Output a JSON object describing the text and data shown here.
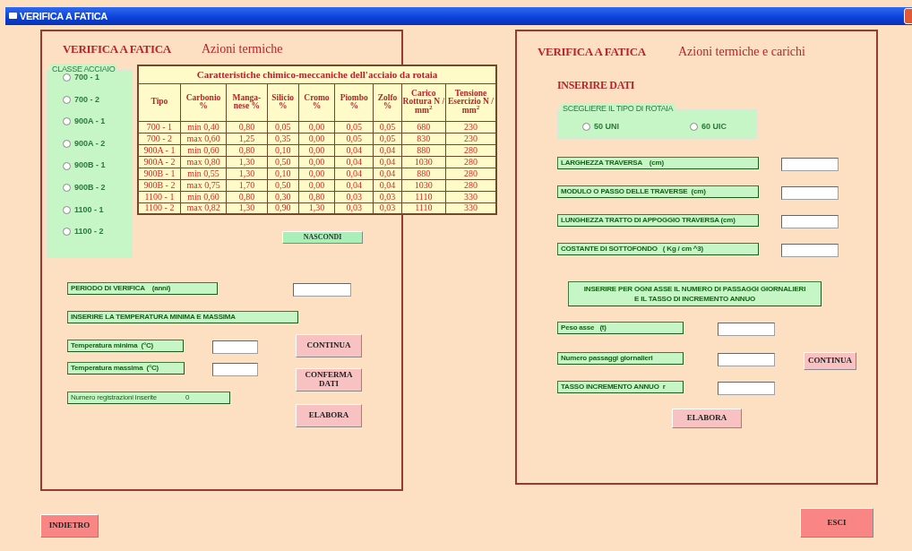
{
  "window": {
    "title": "VERIFICA A FATICA"
  },
  "left_panel": {
    "title": "VERIFICA A FATICA",
    "subtitle": "Azioni termiche",
    "steel_class": {
      "label": "CLASSE ACCIAIO",
      "options": [
        {
          "label": "700 - 1",
          "selected": false
        },
        {
          "label": "700 - 2",
          "selected": false
        },
        {
          "label": "900A - 1",
          "selected": false
        },
        {
          "label": "900A - 2",
          "selected": false
        },
        {
          "label": "900B - 1",
          "selected": false
        },
        {
          "label": "900B - 2",
          "selected": false
        },
        {
          "label": "1100 - 1",
          "selected": false
        },
        {
          "label": "1100 - 2",
          "selected": false
        }
      ]
    },
    "table": {
      "title": "Caratteristiche chimico-meccaniche dell'acciaio da rotaia",
      "columns": [
        "Tipo",
        "Carbonio %",
        "Manga- nese %",
        "Silicio %",
        "Cromo %",
        "Piombo %",
        "Zolfo %",
        "Carico Rottura N / mm$^{2}$",
        "Tensione Esercizio N / mm$^{2}$"
      ],
      "rows": [
        [
          "700 - 1",
          "min 0,40",
          "0,80",
          "0,05",
          "0,00",
          "0,05",
          "0,05",
          "680",
          "230"
        ],
        [
          "700 - 2",
          "max 0,60",
          "1,25",
          "0,35",
          "0,00",
          "0,05",
          "0,05",
          "830",
          "230"
        ],
        [
          "900A - 1",
          "min 0,60",
          "0,80",
          "0,10",
          "0,00",
          "0,04",
          "0,04",
          "880",
          "280"
        ],
        [
          "900A - 2",
          "max 0,80",
          "1,30",
          "0,50",
          "0,00",
          "0,04",
          "0,04",
          "1030",
          "280"
        ],
        [
          "900B - 1",
          "min 0,55",
          "1,30",
          "0,10",
          "0,00",
          "0,04",
          "0,04",
          "880",
          "280"
        ],
        [
          "900B - 2",
          "max 0,75",
          "1,70",
          "0,50",
          "0,00",
          "0,04",
          "0,04",
          "1030",
          "280"
        ],
        [
          "1100 - 1",
          "min 0,60",
          "0,80",
          "0,30",
          "0,80",
          "0,03",
          "0,03",
          "1110",
          "330"
        ],
        [
          "1100 - 2",
          "max 0,82",
          "1,30",
          "0,90",
          "1,30",
          "0,03",
          "0,03",
          "1110",
          "330"
        ]
      ]
    },
    "hide_button": "NASCONDI",
    "items": [
      {
        "kind": "field",
        "label": "PERIODO DI VERIFICA    (anni)"
      },
      {
        "kind": "heading",
        "label": "INSERIRE LA TEMPERATURA MINIMA E MASSIMA"
      },
      {
        "kind": "field",
        "label": "Temperatura minima  (°C)"
      },
      {
        "kind": "field",
        "label": "Temperatura massima  (°C)"
      },
      {
        "kind": "counter",
        "label": "Numero registrazioni inserite",
        "value": "0"
      }
    ],
    "buttons": [
      "CONTINUA",
      "CONFERMA DATI",
      "ELABORA"
    ]
  },
  "right_panel": {
    "title": "VERIFICA A FATICA",
    "subtitle": "Azioni termiche e carichi",
    "heading": "INSERIRE DATI",
    "rail_type": {
      "label": "SCEGLIERE IL TIPO DI ROTAIA",
      "options": [
        {
          "label": "50 UNI",
          "selected": false
        },
        {
          "label": "60 UIC",
          "selected": false
        }
      ]
    },
    "items": [
      {
        "kind": "field",
        "label": "LARGHEZZA TRAVERSA    (cm)"
      },
      {
        "kind": "field",
        "label": "MODULO O PASSO DELLE TRAVERSE  (cm)"
      },
      {
        "kind": "field",
        "label": "LUNGHEZZA TRATTO DI APPOGGIO TRAVERSA (cm)"
      },
      {
        "kind": "field",
        "label": "COSTANTE DI SOTTOFONDO   ( Kg / cm ^3)"
      },
      {
        "kind": "note",
        "lines": [
          "INSERIRE PER OGNI ASSE IL NUMERO DI PASSAGGI GIORNALIERI",
          "E IL TASSO DI INCREMENTO ANNUO"
        ]
      },
      {
        "kind": "field",
        "label": "Peso asse   (t)"
      },
      {
        "kind": "field",
        "label": "Numero passaggi giornalieri"
      },
      {
        "kind": "field",
        "label": "TASSO INCREMENTO ANNUO  r"
      }
    ],
    "buttons": [
      "CONTINUA",
      "ELABORA"
    ]
  },
  "footer_buttons": [
    "INDIETRO",
    "ESCI"
  ]
}
